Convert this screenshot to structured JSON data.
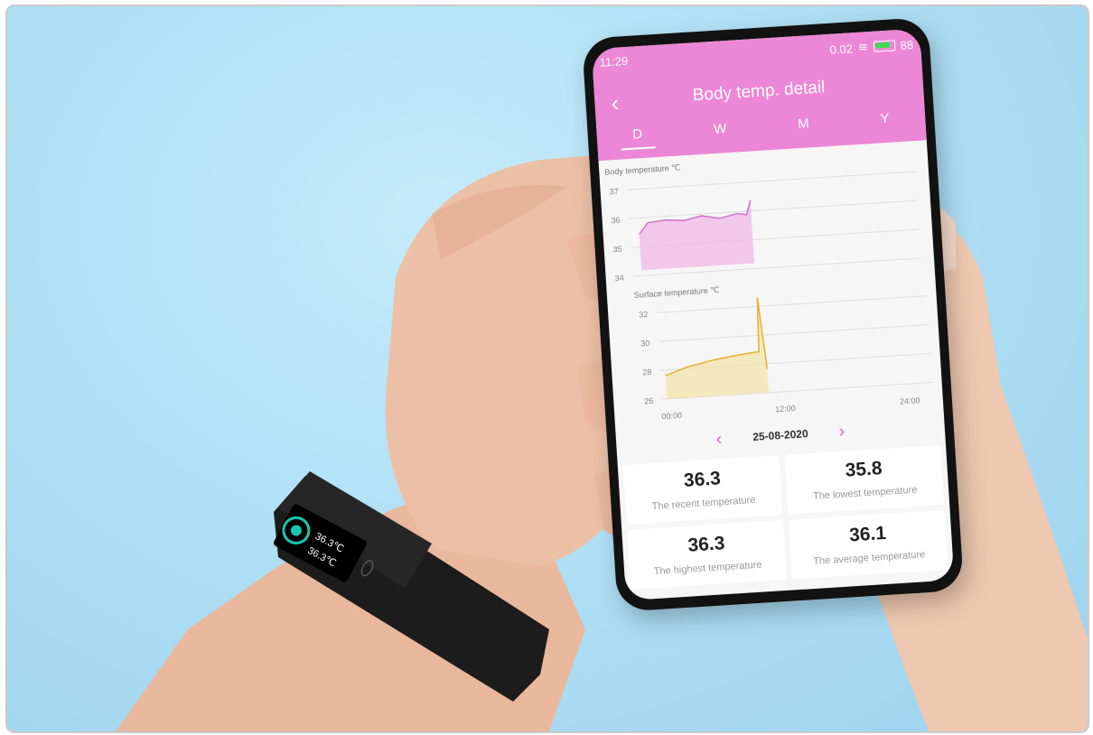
{
  "phone": {
    "status_time": "11:29",
    "status_speed": "0.02",
    "battery": "88",
    "title": "Body temp. detail",
    "tabs": [
      "D",
      "W",
      "M",
      "Y"
    ],
    "active_tab": "D"
  },
  "charts": {
    "body": {
      "label": "Body temperature ℃",
      "ticks": [
        "37",
        "36",
        "35",
        "34"
      ]
    },
    "surface": {
      "label": "Surface temperature ℃",
      "ticks": [
        "32",
        "30",
        "28",
        "26"
      ],
      "x_ticks": [
        "00:00",
        "12:00",
        "24:00"
      ]
    }
  },
  "date": "25-08-2020",
  "stats": [
    {
      "value": "36.3",
      "label": "The recent temperature"
    },
    {
      "value": "35.8",
      "label": "The lowest temperature"
    },
    {
      "value": "36.3",
      "label": "The highest temperature"
    },
    {
      "value": "36.1",
      "label": "The average temperature"
    }
  ],
  "band": {
    "value_1": "36.3℃",
    "value_2": "36.3℃"
  },
  "colors": {
    "header": "#ec86d6",
    "body_line": "#d46fcd",
    "surface_line": "#e4b12c",
    "background": "#b4e3f6"
  }
}
